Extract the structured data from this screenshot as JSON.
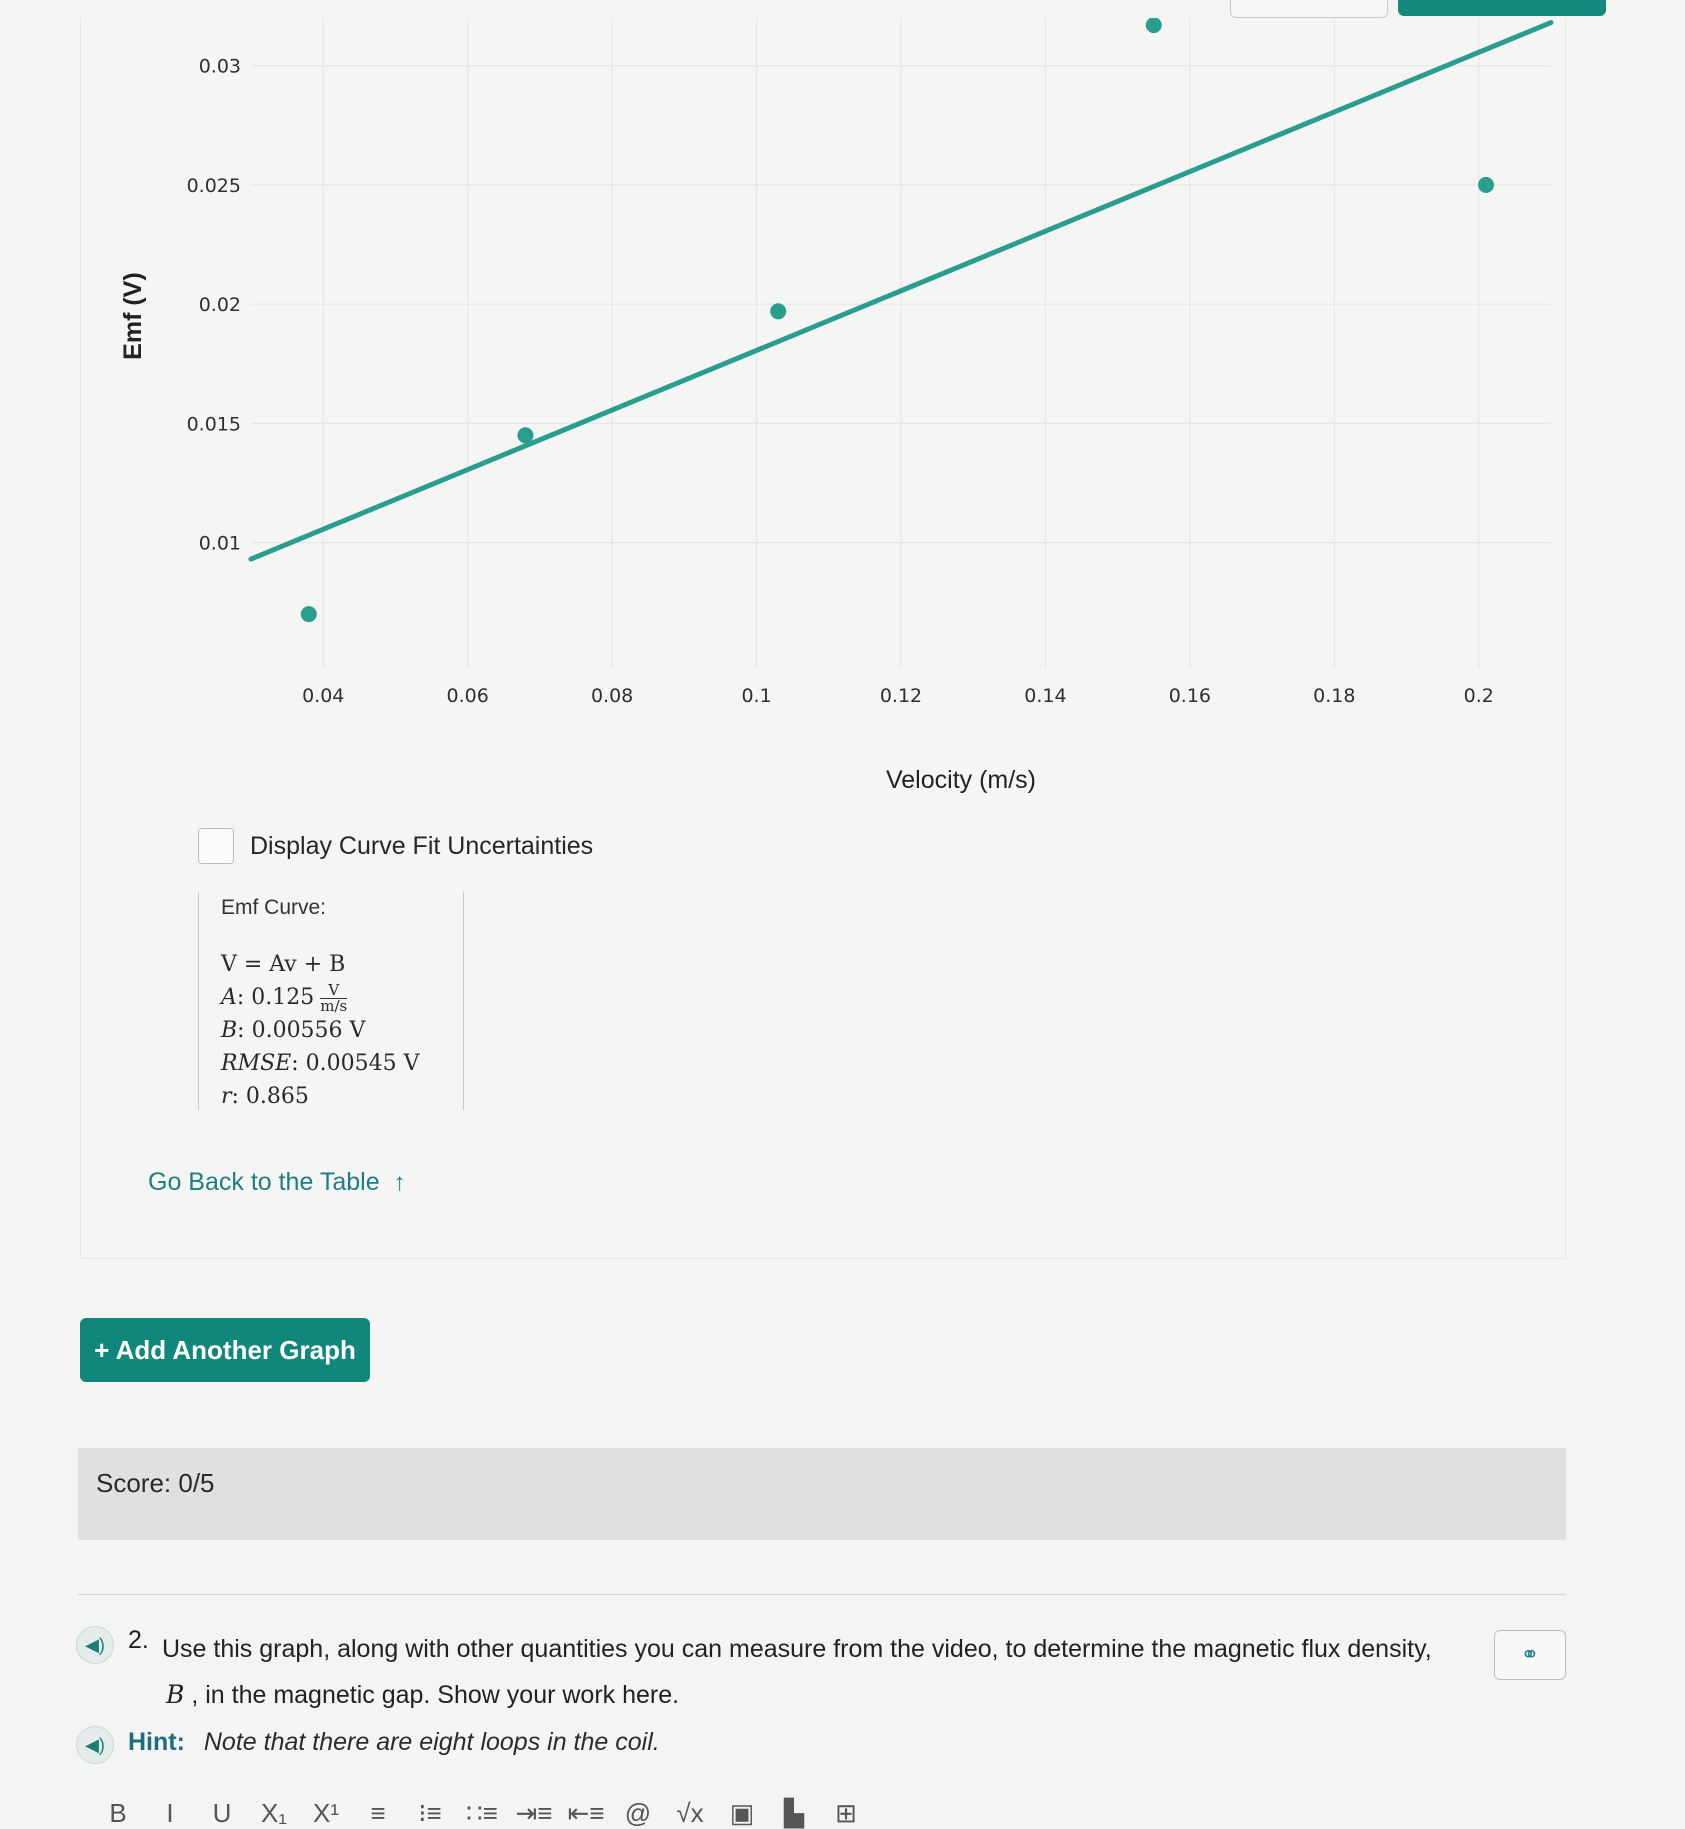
{
  "chart_data": {
    "type": "scatter",
    "xlabel": "Velocity (m/s)",
    "ylabel": "Emf (V)",
    "x_ticks": [
      "0.04",
      "0.06",
      "0.08",
      "0.1",
      "0.12",
      "0.14",
      "0.16",
      "0.18",
      "0.2"
    ],
    "y_ticks": [
      "0.01",
      "0.015",
      "0.02",
      "0.025",
      "0.03"
    ],
    "xlim": [
      0.03,
      0.21
    ],
    "ylim": [
      0.006,
      0.032
    ],
    "points": [
      {
        "x": 0.038,
        "y": 0.007
      },
      {
        "x": 0.068,
        "y": 0.0145
      },
      {
        "x": 0.103,
        "y": 0.0197
      },
      {
        "x": 0.155,
        "y": 0.0317
      },
      {
        "x": 0.201,
        "y": 0.025
      }
    ],
    "fit": {
      "slope": 0.125,
      "intercept": 0.00556,
      "x_range": [
        0.03,
        0.21
      ]
    },
    "grid": true,
    "colors": {
      "series": "#2a9e8e"
    }
  },
  "controls": {
    "uncertainty_checkbox_label": "Display Curve Fit Uncertainties",
    "uncertainty_checked": false
  },
  "fit_box": {
    "title": "Emf Curve:",
    "equation": "V = Av + B",
    "a_label": "A",
    "a_value": ": 0.125",
    "a_unit_num": "V",
    "a_unit_den": "m/s",
    "b_label": "B",
    "b_value": ": 0.00556 V",
    "rmse_label": "RMSE",
    "rmse_value": ": 0.00545 V",
    "r_label": "r",
    "r_value": ": 0.865"
  },
  "go_back": {
    "label": "Go Back to the Table",
    "arrow": "↑"
  },
  "add_graph": {
    "label": "+ Add Another Graph"
  },
  "score": {
    "text": "Score: 0/5"
  },
  "question": {
    "number": "2.",
    "text_before": "Use this graph, along with other quantities you can measure from the video, to determine the magnetic flux density,",
    "math_symbol": "B",
    "text_after": ", in the magnetic gap. Show your work here."
  },
  "hint": {
    "label": "Hint:",
    "text": "Note that there are eight loops in the coil."
  },
  "icons": {
    "speaker": "speaker-icon",
    "link": "link-icon"
  },
  "toolbar": {
    "items": [
      "B",
      "I",
      "U",
      "X₁",
      "X¹",
      "≡",
      "⁝≡",
      "∷≡",
      "⇥≡",
      "⇤≡",
      "@",
      "√x",
      "▣",
      "▙",
      "⊞"
    ]
  }
}
